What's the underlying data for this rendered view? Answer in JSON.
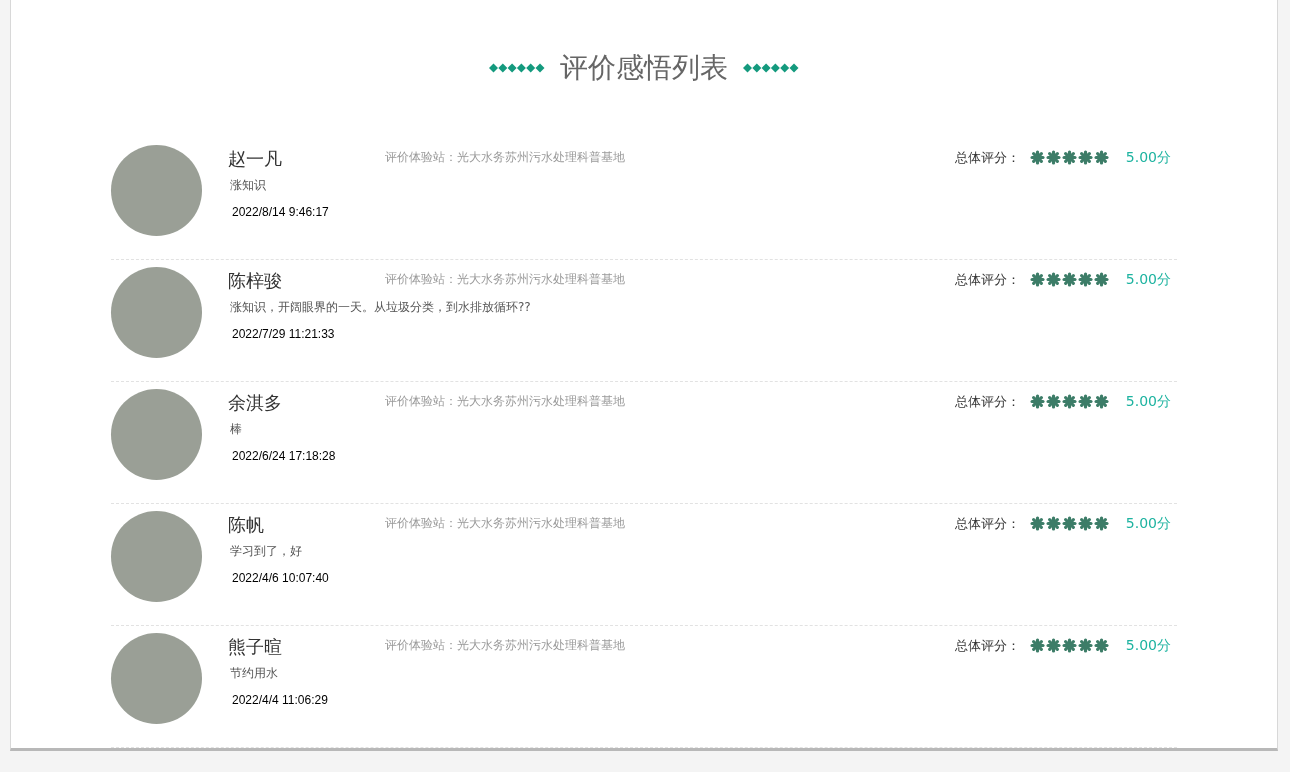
{
  "title": "评价感悟列表",
  "reviews": [
    {
      "name": "赵一凡",
      "station": "评价体验站：光大水务苏州污水处理科普基地",
      "comment": "涨知识",
      "time": "2022/8/14 9:46:17",
      "rating_label": "总体评分：",
      "stars": 5,
      "score": "5.00分"
    },
    {
      "name": "陈梓骏",
      "station": "评价体验站：光大水务苏州污水处理科普基地",
      "comment": "涨知识，开阔眼界的一天。从垃圾分类，到水排放循环??",
      "time": "2022/7/29 11:21:33",
      "rating_label": "总体评分：",
      "stars": 5,
      "score": "5.00分"
    },
    {
      "name": "余淇多",
      "station": "评价体验站：光大水务苏州污水处理科普基地",
      "comment": "棒",
      "time": "2022/6/24 17:18:28",
      "rating_label": "总体评分：",
      "stars": 5,
      "score": "5.00分"
    },
    {
      "name": "陈帆",
      "station": "评价体验站：光大水务苏州污水处理科普基地",
      "comment": "学习到了，好",
      "time": "2022/4/6 10:07:40",
      "rating_label": "总体评分：",
      "stars": 5,
      "score": "5.00分"
    },
    {
      "name": "熊子暄",
      "station": "评价体验站：光大水务苏州污水处理科普基地",
      "comment": "节约用水",
      "time": "2022/4/4 11:06:29",
      "rating_label": "总体评分：",
      "stars": 5,
      "score": "5.00分"
    }
  ]
}
